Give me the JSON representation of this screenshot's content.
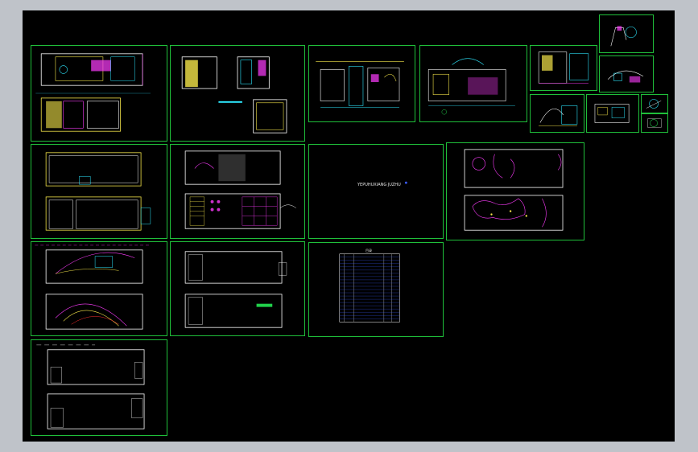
{
  "window": {
    "background_color": "#bfc3c9",
    "canvas_color": "#000000",
    "sheet_border_color": "#1fbf3a"
  },
  "sheets": {
    "top_left_plan": {
      "title": ""
    },
    "top_second_plan": {
      "title": ""
    },
    "cover": {
      "title": "YEPUHUXIANG JUZHU"
    },
    "schedule": {
      "label": "目录"
    }
  },
  "colors": {
    "wall": "#ffffff",
    "line_yellow": "#f5e64a",
    "line_cyan": "#2ee8ff",
    "line_magenta": "#ff3cff",
    "line_red": "#ff3030",
    "line_blue": "#3a5bff",
    "line_green": "#21d14b"
  }
}
